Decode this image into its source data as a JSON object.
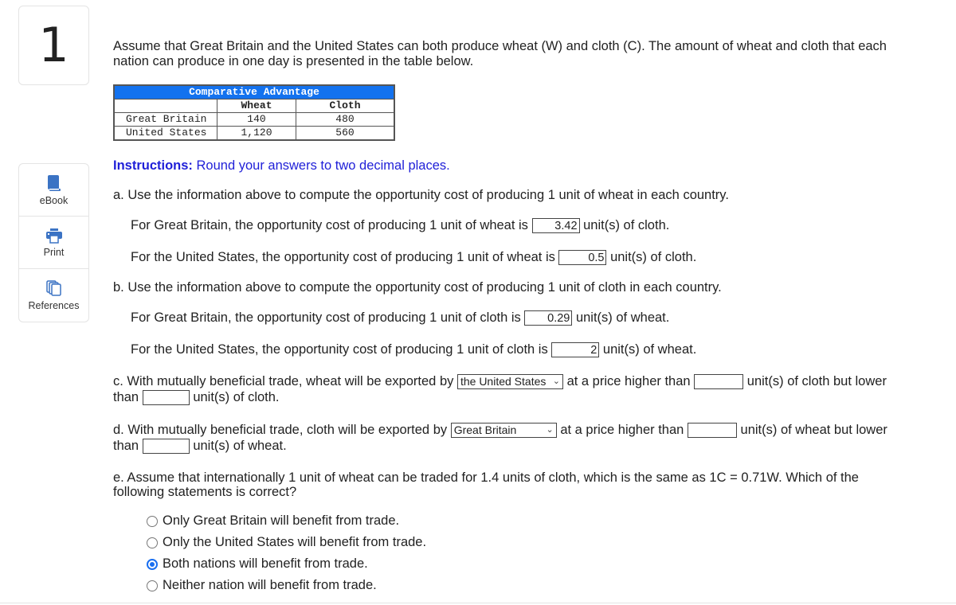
{
  "question_number": "1",
  "sidebar": {
    "items": [
      {
        "label": "eBook",
        "icon": "book-icon"
      },
      {
        "label": "Print",
        "icon": "printer-icon"
      },
      {
        "label": "References",
        "icon": "references-icon"
      }
    ]
  },
  "intro": "Assume that Great Britain and the United States can both produce wheat (W) and cloth (C). The amount of wheat and cloth that each nation can produce in one day is presented in the table below.",
  "table": {
    "title": "Comparative Advantage",
    "headers": [
      "",
      "Wheat",
      "Cloth"
    ],
    "rows": [
      [
        "Great Britain",
        "140",
        "480"
      ],
      [
        "United States",
        "1,120",
        "560"
      ]
    ]
  },
  "instructions": {
    "label": "Instructions:",
    "text": " Round your answers to two decimal places."
  },
  "part_a": {
    "prompt": "a. Use the information above to compute the opportunity cost of producing 1 unit of wheat in each country.",
    "gb_prefix": "For Great Britain, the opportunity cost of producing 1 unit of wheat is",
    "gb_value": "3.42",
    "gb_suffix": "unit(s) of cloth.",
    "us_prefix": "For the United States, the opportunity cost of producing 1 unit of wheat is",
    "us_value": "0.5",
    "us_suffix": "unit(s) of cloth."
  },
  "part_b": {
    "prompt": "b. Use the information above to compute the opportunity cost of producing 1 unit of cloth in each country.",
    "gb_prefix": "For Great Britain, the opportunity cost of producing 1 unit of cloth is",
    "gb_value": "0.29",
    "gb_suffix": "unit(s) of wheat.",
    "us_prefix": "For the United States, the opportunity cost of producing 1 unit of cloth is",
    "us_value": "2",
    "us_suffix": "unit(s) of wheat."
  },
  "part_c": {
    "prefix": "c. With mutually beneficial trade, wheat will be exported by",
    "select_value": "the United States",
    "mid": "at a price higher than",
    "low_value": "",
    "after_low": "unit(s) of cloth but lower",
    "than": "than",
    "high_value": "",
    "suffix": "unit(s) of cloth."
  },
  "part_d": {
    "prefix": "d. With mutually beneficial trade, cloth will be exported by",
    "select_value": "Great Britain",
    "mid": "at a price higher than",
    "low_value": "",
    "after_low": "unit(s) of wheat but lower",
    "than": "than",
    "high_value": "",
    "suffix": "unit(s) of wheat."
  },
  "part_e": {
    "line1": "e. Assume that internationally 1 unit of wheat can be traded for 1.4 units of cloth, which is the same as 1C = 0.71W. Which of the",
    "line2": "following statements is correct?",
    "options": [
      {
        "label": "Only Great Britain will benefit from trade.",
        "selected": false
      },
      {
        "label": "Only the United States will benefit from trade.",
        "selected": false
      },
      {
        "label": "Both nations will benefit from trade.",
        "selected": true
      },
      {
        "label": "Neither nation will benefit from trade.",
        "selected": false
      }
    ]
  }
}
